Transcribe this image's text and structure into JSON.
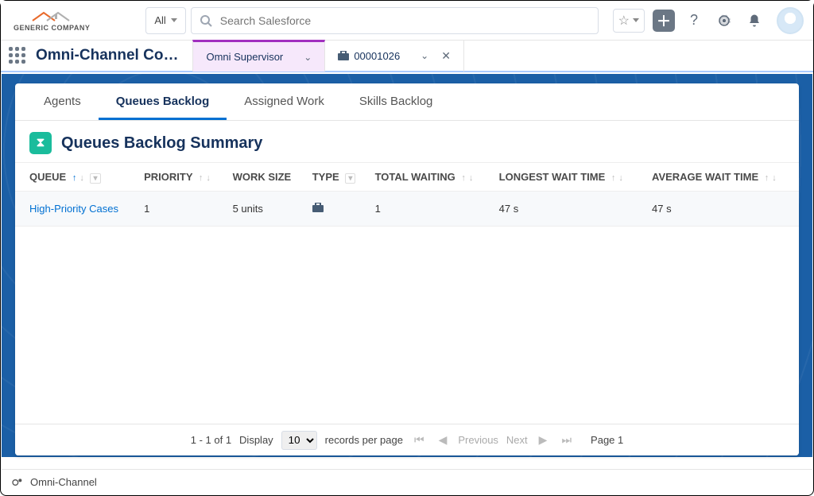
{
  "header": {
    "logo_text": "GENERIC COMPANY",
    "scope_label": "All",
    "search_placeholder": "Search Salesforce"
  },
  "app": {
    "name": "Omni-Channel Co…",
    "tabs": [
      {
        "label": "Omni Supervisor",
        "active": true
      },
      {
        "label": "00001026",
        "icon": "briefcase",
        "closable": true
      }
    ]
  },
  "subtabs": [
    "Agents",
    "Queues Backlog",
    "Assigned Work",
    "Skills Backlog"
  ],
  "active_subtab": "Queues Backlog",
  "page_title": "Queues Backlog Summary",
  "columns": {
    "queue": "QUEUE",
    "priority": "PRIORITY",
    "work_size": "WORK SIZE",
    "type": "TYPE",
    "total_waiting": "TOTAL WAITING",
    "longest_wait": "LONGEST WAIT TIME",
    "avg_wait": "AVERAGE WAIT TIME"
  },
  "rows": [
    {
      "queue": "High-Priority Cases",
      "priority": "1",
      "work_size": "5 units",
      "type_icon": "briefcase",
      "total_waiting": "1",
      "longest_wait": "47 s",
      "avg_wait": "47 s"
    }
  ],
  "pager": {
    "range": "1 - 1 of 1",
    "display_label": "Display",
    "page_size": "10",
    "records_label": "records per page",
    "prev": "Previous",
    "next": "Next",
    "page_label": "Page 1"
  },
  "footer": {
    "label": "Omni-Channel"
  }
}
